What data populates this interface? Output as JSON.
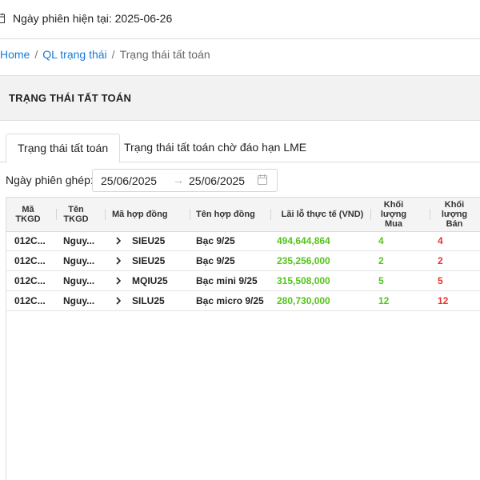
{
  "topbar": {
    "session_label": "Ngày phiên hiện tại: 2025-06-26"
  },
  "breadcrumb": {
    "home": "Home",
    "sep": "/",
    "parent": "QL trạng thái",
    "current": "Trạng thái tất toán"
  },
  "page": {
    "title": "TRẠNG THÁI TẤT TOÁN"
  },
  "tabs": [
    {
      "label": "Trạng thái tất toán",
      "active": true
    },
    {
      "label": "Trạng thái tất toán chờ đáo hạn LME",
      "active": false
    }
  ],
  "filter": {
    "label": "Ngày phiên ghép:",
    "from": "25/06/2025",
    "arrow": "→",
    "to": "25/06/2025"
  },
  "table": {
    "headers": {
      "ma_tkgd": "Mã TKGD",
      "ten_tkgd": "Tên TKGD",
      "ma_hop_dong": "Mã hợp đồng",
      "ten_hop_dong": "Tên hợp đồng",
      "lai_lo": "Lãi lỗ thực tế (VND)",
      "kl_mua": "Khối lượng Mua",
      "kl_ban": "Khối lượng Bán"
    },
    "rows": [
      {
        "ma_tkgd": "012C...",
        "ten_tkgd": "Nguy...",
        "ma_hop_dong": "SIEU25",
        "ten_hop_dong": "Bạc 9/25",
        "lai_lo": "494,644,864",
        "kl_mua": "4",
        "kl_ban": "4"
      },
      {
        "ma_tkgd": "012C...",
        "ten_tkgd": "Nguy...",
        "ma_hop_dong": "SIEU25",
        "ten_hop_dong": "Bạc 9/25",
        "lai_lo": "235,256,000",
        "kl_mua": "2",
        "kl_ban": "2"
      },
      {
        "ma_tkgd": "012C...",
        "ten_tkgd": "Nguy...",
        "ma_hop_dong": "MQIU25",
        "ten_hop_dong": "Bạc mini 9/25",
        "lai_lo": "315,508,000",
        "kl_mua": "5",
        "kl_ban": "5"
      },
      {
        "ma_tkgd": "012C...",
        "ten_tkgd": "Nguy...",
        "ma_hop_dong": "SILU25",
        "ten_hop_dong": "Bạc micro 9/25",
        "lai_lo": "280,730,000",
        "kl_mua": "12",
        "kl_ban": "12"
      }
    ]
  },
  "colors": {
    "link": "#1a7ad9",
    "positive": "#52c41a",
    "negative": "#e8332f",
    "header_bg": "#f2f2f2"
  },
  "icons": {
    "session": "calendar-icon",
    "range": "calendar-icon",
    "expand": "chevron-right-icon"
  }
}
